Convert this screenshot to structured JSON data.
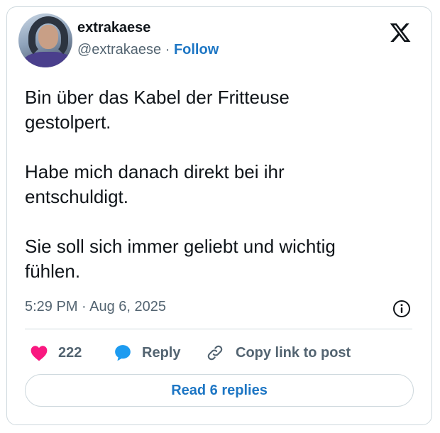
{
  "author": {
    "name": "extrakaese",
    "handle": "@extrakaese",
    "separator": "·",
    "follow_label": "Follow"
  },
  "tweet": {
    "text": "Bin über das Kabel der Fritteuse\ngestolpert.\n\nHabe mich danach direkt bei ihr\nentschuldigt.\n\nSie soll sich immer geliebt und wichtig\nfühlen.",
    "timestamp": "5:29 PM · Aug 6, 2025"
  },
  "actions": {
    "like_count": "222",
    "reply_label": "Reply",
    "copy_link_label": "Copy link to post"
  },
  "read_replies_label": "Read 6 replies",
  "colors": {
    "heart": "#f91880",
    "reply_bubble": "#1d9bf0",
    "link_blue": "#1d76c4",
    "muted_text": "#536471",
    "border": "#cfd9de"
  },
  "icons": [
    "x-logo-icon",
    "info-icon",
    "heart-icon",
    "reply-bubble-icon",
    "link-icon"
  ]
}
